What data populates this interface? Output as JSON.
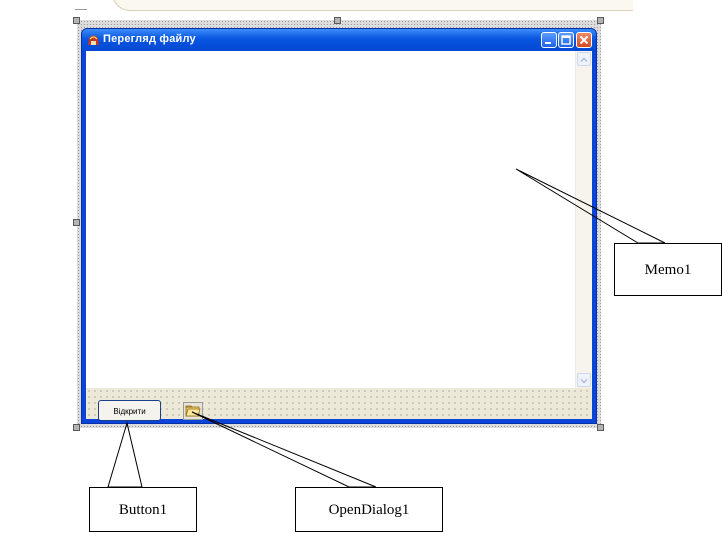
{
  "window": {
    "title": "Перегляд файлу"
  },
  "panel": {
    "open_button_label": "Відкрити"
  },
  "callouts": {
    "memo_label": "Memo1",
    "button_label": "Button1",
    "dialog_label": "OpenDialog1"
  },
  "colors": {
    "title_bar": "#0856e0",
    "window_border": "#0a44d8",
    "client_background": "#ece9d8",
    "close_button": "#d24a22"
  },
  "icons": {
    "app": "app-icon",
    "minimize": "minimize-icon",
    "maximize": "maximize-icon",
    "close": "close-icon",
    "scroll_up": "scroll-up-arrow-icon",
    "scroll_down": "scroll-down-arrow-icon",
    "open_dialog": "open-dialog-folder-icon"
  }
}
